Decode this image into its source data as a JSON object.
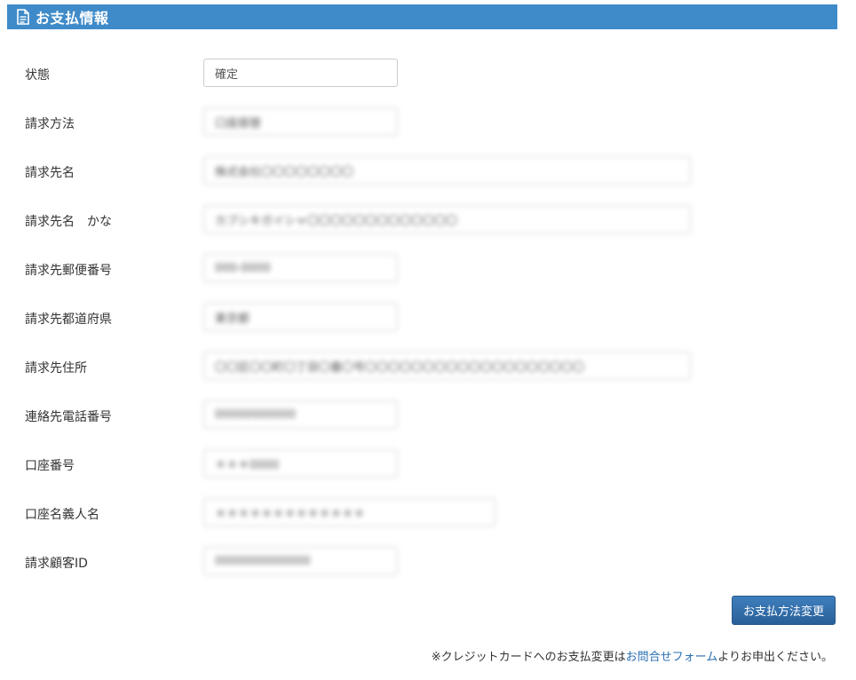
{
  "header": {
    "title": "お支払情報",
    "icon": "document-icon"
  },
  "form": {
    "fields": [
      {
        "label": "状態",
        "value": "確定",
        "blurred": false
      },
      {
        "label": "請求方法",
        "value": "口座振替",
        "blurred": true
      },
      {
        "label": "請求先名",
        "value": "株式会社〇〇〇〇〇〇〇〇",
        "blurred": true
      },
      {
        "label": "請求先名　かな",
        "value": "カブシキガイシャ〇〇〇〇〇〇〇〇〇〇〇〇〇",
        "blurred": true
      },
      {
        "label": "請求先郵便番号",
        "value": "000-0000",
        "blurred": true
      },
      {
        "label": "請求先都道府県",
        "value": "東京都",
        "blurred": true
      },
      {
        "label": "請求先住所",
        "value": "〇〇区〇〇町〇丁目〇番〇号〇〇〇〇〇〇〇〇〇〇〇〇〇〇〇〇〇〇〇",
        "blurred": true
      },
      {
        "label": "連絡先電話番号",
        "value": "00000000000",
        "blurred": true
      },
      {
        "label": "口座番号",
        "value": "＊＊＊0000",
        "blurred": true
      },
      {
        "label": "口座名義人名",
        "value": "＊＊＊＊＊＊＊＊＊＊＊＊＊",
        "blurred": true
      },
      {
        "label": "請求顧客ID",
        "value": "0000000000000",
        "blurred": true
      }
    ]
  },
  "actions": {
    "change_payment_label": "お支払方法変更"
  },
  "note": {
    "prefix": "※クレジットカードへのお支払変更は",
    "link_text": "お問合せフォーム",
    "suffix": "よりお申出ください。"
  },
  "colors": {
    "header_bg": "#3f8bc9",
    "button_bg": "#2f6da8",
    "link": "#2a6fb3"
  }
}
